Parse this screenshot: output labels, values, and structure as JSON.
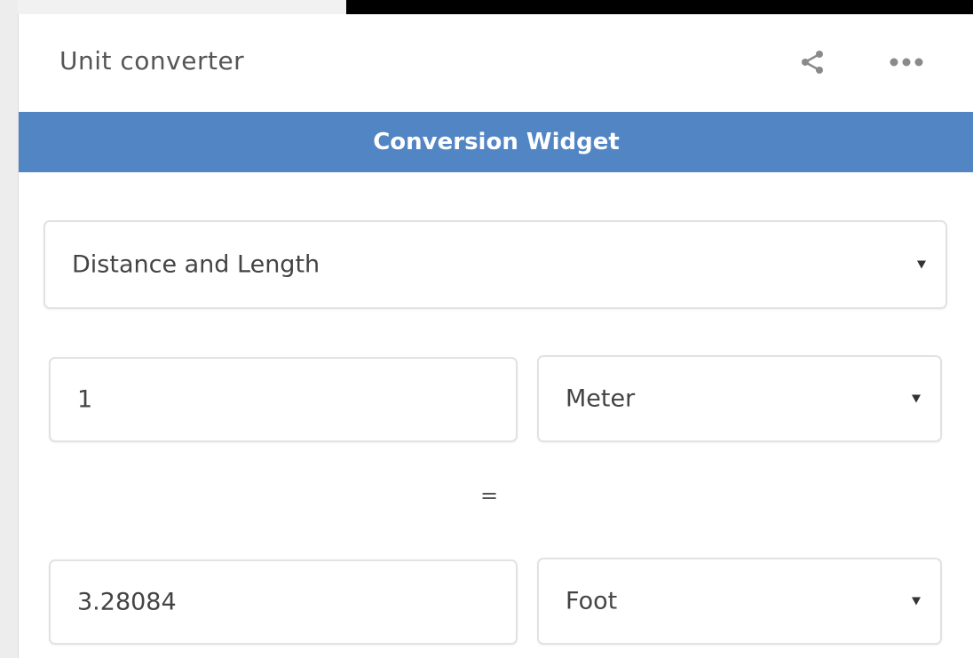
{
  "header": {
    "title": "Unit converter",
    "icons": {
      "share": "share-icon",
      "more": "more-options-icon"
    }
  },
  "widget": {
    "title": "Conversion Widget",
    "accent_color": "#5185c4"
  },
  "category": {
    "selected": "Distance and Length"
  },
  "from": {
    "value": "1",
    "unit": "Meter"
  },
  "equals_sign": "=",
  "to": {
    "value": "3.28084",
    "unit": "Foot"
  }
}
